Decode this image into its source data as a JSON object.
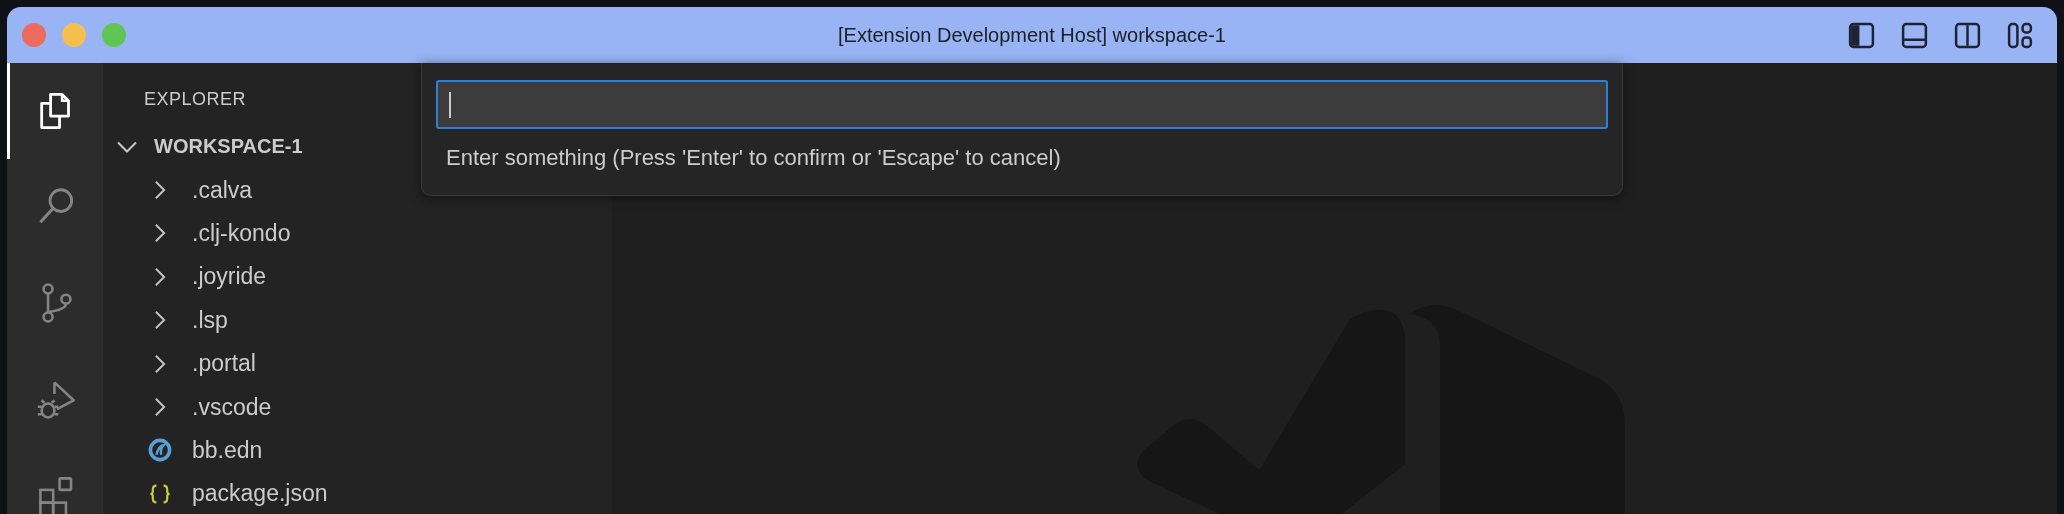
{
  "window": {
    "title": "[Extension Development Host] workspace-1",
    "layout_controls": [
      {
        "kind": "primary-sidebar",
        "on": true
      },
      {
        "kind": "panel",
        "on": false
      },
      {
        "kind": "secondary-sidebar",
        "on": false
      },
      {
        "kind": "customize",
        "on": false
      }
    ]
  },
  "activity_bar": [
    {
      "kind": "explorer",
      "selected": true
    },
    {
      "kind": "search",
      "selected": false
    },
    {
      "kind": "source-control",
      "selected": false
    },
    {
      "kind": "run-debug",
      "selected": false
    },
    {
      "kind": "extensions",
      "selected": false
    }
  ],
  "sidebar": {
    "title": "EXPLORER",
    "workspace": {
      "label": "WORKSPACE-1",
      "expanded": true,
      "children": [
        {
          "label": ".calva",
          "kind": "folder",
          "expanded": false
        },
        {
          "label": ".clj-kondo",
          "kind": "folder",
          "expanded": false
        },
        {
          "label": ".joyride",
          "kind": "folder",
          "expanded": false
        },
        {
          "label": ".lsp",
          "kind": "folder",
          "expanded": false
        },
        {
          "label": ".portal",
          "kind": "folder",
          "expanded": false
        },
        {
          "label": ".vscode",
          "kind": "folder",
          "expanded": false
        },
        {
          "label": "bb.edn",
          "kind": "clojure"
        },
        {
          "label": "package.json",
          "kind": "json"
        }
      ]
    }
  },
  "quick_input": {
    "focused": true,
    "message": "Enter something (Press 'Enter' to confirm or 'Escape' to cancel)"
  }
}
